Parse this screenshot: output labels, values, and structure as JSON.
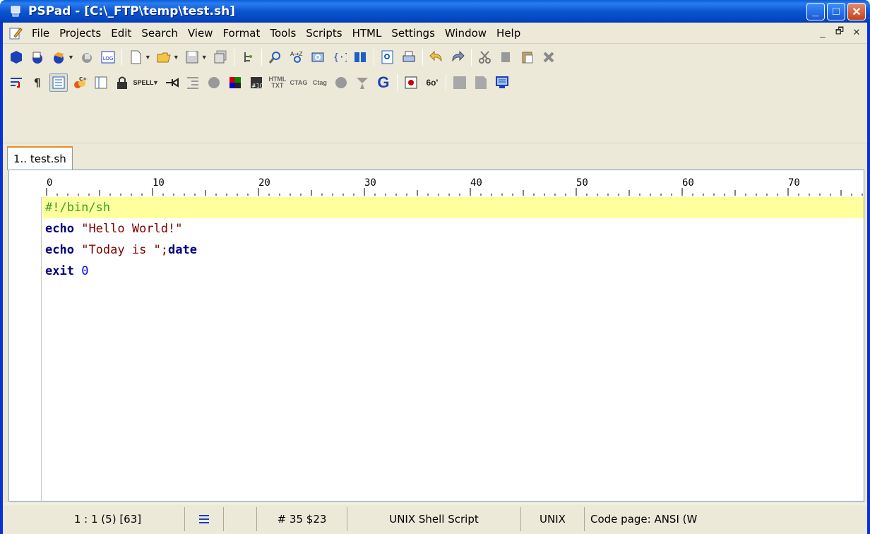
{
  "window": {
    "title": "PSPad - [C:\\_FTP\\temp\\test.sh]",
    "controls": {
      "minimize": "_",
      "maximize": "□",
      "close": "✕"
    }
  },
  "menu": {
    "items": [
      "File",
      "Projects",
      "Edit",
      "Search",
      "View",
      "Format",
      "Tools",
      "Scripts",
      "HTML",
      "Settings",
      "Window",
      "Help"
    ],
    "mdi_controls": {
      "minimize": "_",
      "restore": "🗗",
      "close": "✕"
    }
  },
  "toolbar2": {
    "spell_label": "SPELL",
    "html_label_top": "HTML",
    "html_label_bottom": "TXT",
    "tag1_label": "CTAG",
    "tag2_label": "Ctag",
    "g_label": "G",
    "glasses_label": "6o'"
  },
  "tabs": [
    {
      "label": "1.. test.sh"
    }
  ],
  "ruler": {
    "marks": [
      "0",
      "10",
      "20",
      "30",
      "40",
      "50",
      "60",
      "70"
    ]
  },
  "editor": {
    "lines": [
      {
        "segments": [
          {
            "t": "#!/bin/sh",
            "c": "cmt"
          }
        ]
      },
      {
        "segments": [
          {
            "t": "echo",
            "c": "kw"
          },
          {
            "t": " ",
            "c": ""
          },
          {
            "t": "\"Hello World!\"",
            "c": "str"
          }
        ]
      },
      {
        "segments": [
          {
            "t": "echo",
            "c": "kw"
          },
          {
            "t": " ",
            "c": ""
          },
          {
            "t": "\"Today is \"",
            "c": "str"
          },
          {
            "t": ";",
            "c": "str"
          },
          {
            "t": "date",
            "c": "kw"
          }
        ]
      },
      {
        "segments": [
          {
            "t": "exit",
            "c": "kw"
          },
          {
            "t": " ",
            "c": ""
          },
          {
            "t": "0",
            "c": "num"
          }
        ]
      }
    ]
  },
  "status": {
    "position": "1 : 1  (5)  [63]",
    "hash": "#  35 $23",
    "syntax": "UNIX Shell Script",
    "line_end": "UNIX",
    "codepage": "Code page: ANSI (W"
  }
}
